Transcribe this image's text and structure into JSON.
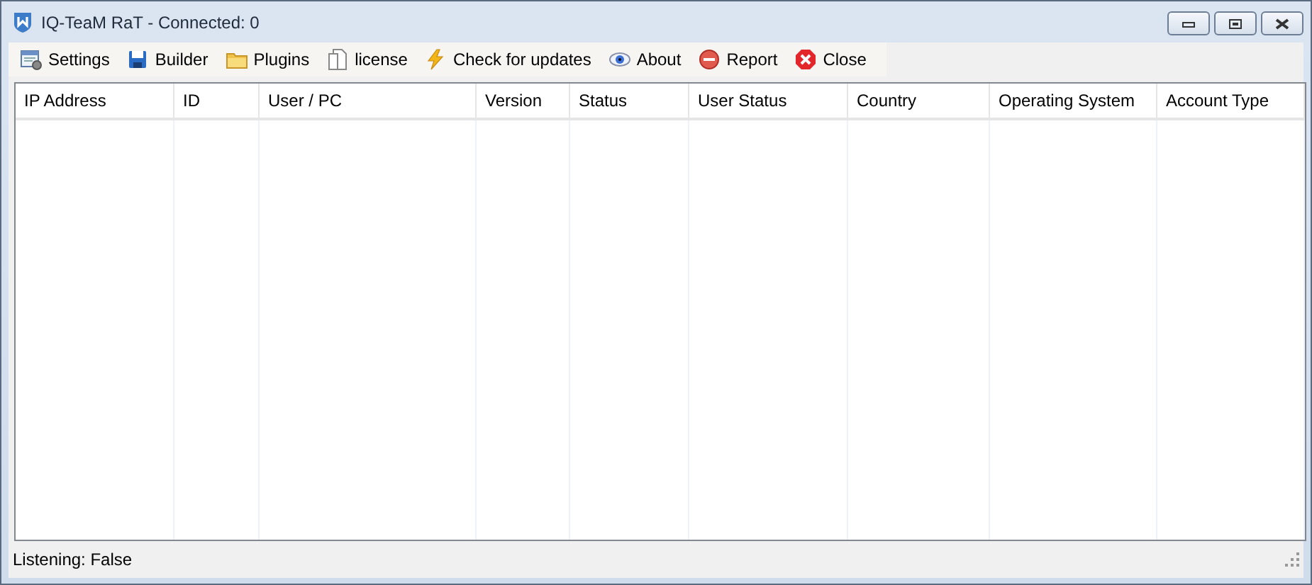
{
  "window": {
    "title": "IQ-TeaM RaT - Connected: 0"
  },
  "toolbar": [
    {
      "label": "Settings",
      "kind": "settings"
    },
    {
      "label": "Builder",
      "kind": "save"
    },
    {
      "label": "Plugins",
      "kind": "folder"
    },
    {
      "label": "license",
      "kind": "document"
    },
    {
      "label": "Check for updates",
      "kind": "lightning"
    },
    {
      "label": "About",
      "kind": "eye"
    },
    {
      "label": "Report",
      "kind": "minus"
    },
    {
      "label": "Close",
      "kind": "close"
    }
  ],
  "table": {
    "columns": [
      "IP Address",
      "ID",
      "User / PC",
      "Version",
      "Status",
      "User Status",
      "Country",
      "Operating System",
      "Account Type"
    ]
  },
  "status_bar": "Listening: False"
}
